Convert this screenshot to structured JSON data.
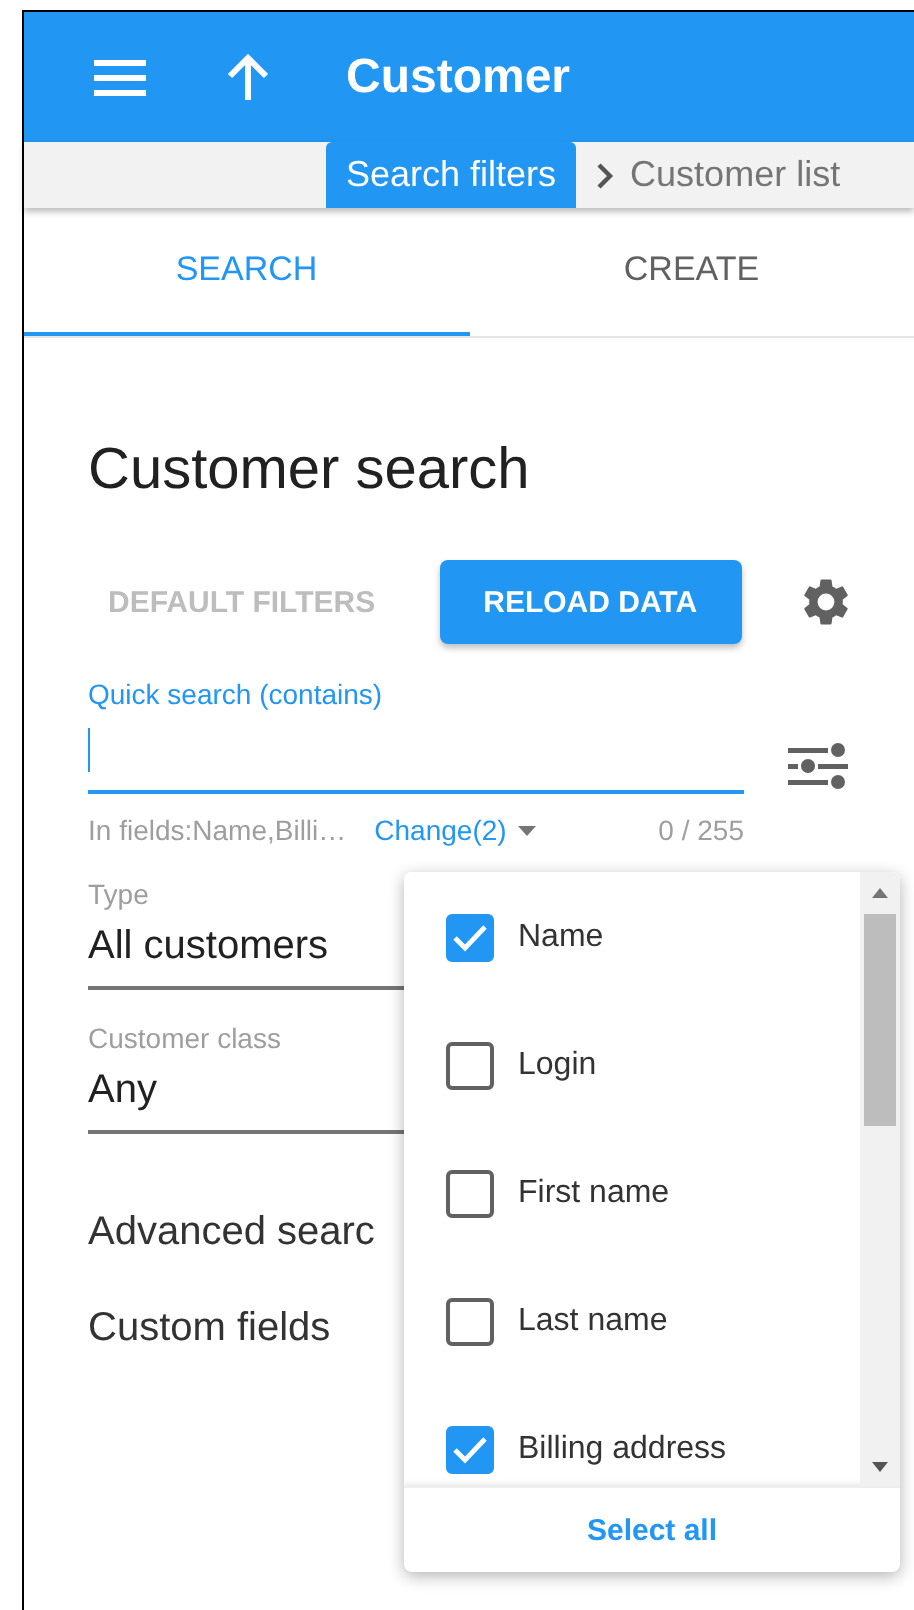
{
  "app_bar": {
    "title": "Customer"
  },
  "breadcrumbs": [
    {
      "label": "Search filters",
      "selected": true
    },
    {
      "label": "Customer list",
      "selected": false
    }
  ],
  "tabs": [
    {
      "label": "SEARCH",
      "selected": true
    },
    {
      "label": "CREATE",
      "selected": false
    }
  ],
  "heading": "Customer search",
  "actions": [
    {
      "label": "DEFAULT FILTERS",
      "kind": "text",
      "disabled": true
    },
    {
      "label": "RELOAD DATA",
      "kind": "raised",
      "disabled": false
    }
  ],
  "quick_search": {
    "label": "Quick search (contains)",
    "focused": true,
    "fields_hint": "In fields:Name,Billi…",
    "change_link": "Change(2)",
    "counter": "0 / 255"
  },
  "fields": [
    {
      "label": "Type",
      "value": "All customers"
    },
    {
      "label": "Customer class",
      "value": "Any"
    }
  ],
  "sections": [
    "Advanced searc",
    "Custom fields"
  ],
  "field_menu": {
    "options": [
      {
        "label": "Name",
        "checked": true
      },
      {
        "label": "Login",
        "checked": false
      },
      {
        "label": "First name",
        "checked": false
      },
      {
        "label": "Last name",
        "checked": false
      },
      {
        "label": "Billing address",
        "checked": true
      }
    ],
    "footer": "Select all"
  }
}
